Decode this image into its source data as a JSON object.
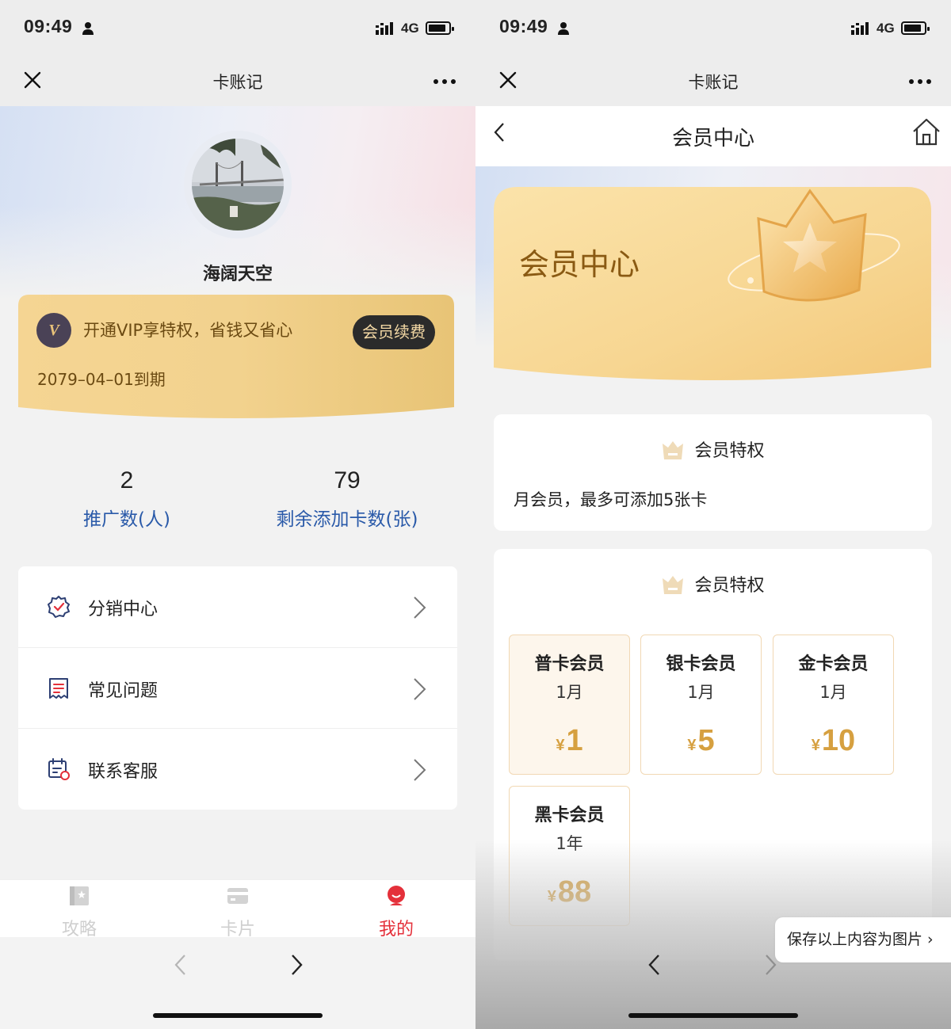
{
  "status_bar": {
    "time": "09:49",
    "network": "4G"
  },
  "left": {
    "nav_title": "卡账记",
    "username": "海阔天空",
    "vip": {
      "badge": "V",
      "promo_text": "开通VIP享特权，省钱又省心",
      "renew_button": "会员续费",
      "expire_text": "2079–04–01到期"
    },
    "stats": [
      {
        "value": "2",
        "label": "推广数(人)"
      },
      {
        "value": "79",
        "label": "剩余添加卡数(张)"
      }
    ],
    "menu": [
      {
        "label": "分销中心",
        "icon": "badge-check-icon"
      },
      {
        "label": "常见问题",
        "icon": "receipt-icon"
      },
      {
        "label": "联系客服",
        "icon": "calendar-service-icon"
      }
    ],
    "tabs": [
      {
        "label": "攻略",
        "icon": "book-icon",
        "active": false
      },
      {
        "label": "卡片",
        "icon": "card-icon",
        "active": false
      },
      {
        "label": "我的",
        "icon": "user-icon",
        "active": true
      }
    ]
  },
  "right": {
    "nav_title": "卡账记",
    "page_title": "会员中心",
    "banner_title": "会员中心",
    "privilege_panel": {
      "heading": "会员特权",
      "description": "月会员，最多可添加5张卡"
    },
    "plans_panel": {
      "heading": "会员特权",
      "plans": [
        {
          "name": "普卡会员",
          "duration": "1月",
          "currency": "¥",
          "price": "1",
          "selected": true
        },
        {
          "name": "银卡会员",
          "duration": "1月",
          "currency": "¥",
          "price": "5",
          "selected": false
        },
        {
          "name": "金卡会员",
          "duration": "1月",
          "currency": "¥",
          "price": "10",
          "selected": false
        },
        {
          "name": "黑卡会员",
          "duration": "1年",
          "currency": "¥",
          "price": "88",
          "selected": false
        }
      ]
    },
    "save_button": "保存以上内容为图片 ›"
  },
  "colors": {
    "accent_red": "#e4303a",
    "link_blue": "#2a5aa9",
    "gold": "#d6a040"
  }
}
